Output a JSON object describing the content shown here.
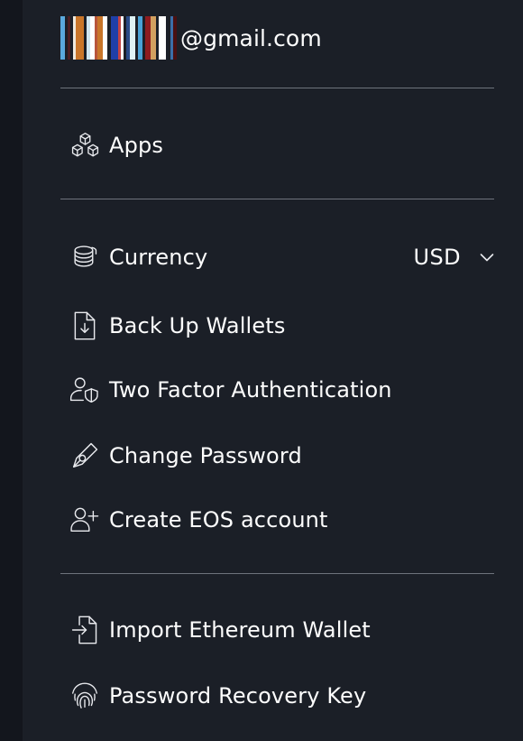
{
  "account": {
    "masked_label": "masked email username",
    "domain": "@gmail.com",
    "mask_bars": [
      {
        "color": "#5aa9dd",
        "width": 5
      },
      {
        "color": "#1b1f27",
        "width": 3
      },
      {
        "color": "#4a1f22",
        "width": 3
      },
      {
        "color": "#1b1f27",
        "width": 3
      },
      {
        "color": "#efeade",
        "width": 3
      },
      {
        "color": "#c9762a",
        "width": 9
      },
      {
        "color": "#1b1f27",
        "width": 3
      },
      {
        "color": "#cfe6f2",
        "width": 4
      },
      {
        "color": "#ffffff",
        "width": 5
      },
      {
        "color": "#b8543a",
        "width": 3
      },
      {
        "color": "#c9762a",
        "width": 6
      },
      {
        "color": "#ffffff",
        "width": 5
      },
      {
        "color": "#1b1f27",
        "width": 4
      },
      {
        "color": "#1f3fa8",
        "width": 8
      },
      {
        "color": "#c24444",
        "width": 3
      },
      {
        "color": "#ffffff",
        "width": 3
      },
      {
        "color": "#1b1f27",
        "width": 3
      },
      {
        "color": "#2a4a86",
        "width": 4
      },
      {
        "color": "#dff3f5",
        "width": 6
      },
      {
        "color": "#1b1f27",
        "width": 3
      },
      {
        "color": "#4aa2d6",
        "width": 5
      },
      {
        "color": "#1b1f27",
        "width": 3
      },
      {
        "color": "#8e1c1f",
        "width": 6
      },
      {
        "color": "#d2a05f",
        "width": 6
      },
      {
        "color": "#1b1f27",
        "width": 3
      },
      {
        "color": "#ffffff",
        "width": 8
      },
      {
        "color": "#1b1f27",
        "width": 5
      },
      {
        "color": "#3b6fa8",
        "width": 3
      },
      {
        "color": "#4a1012",
        "width": 4
      }
    ]
  },
  "sections": [
    {
      "name": "apps",
      "items": [
        {
          "id": "apps",
          "label": "Apps",
          "icon": "cubes-icon"
        }
      ]
    },
    {
      "name": "settings",
      "items": [
        {
          "id": "currency",
          "label": "Currency",
          "icon": "coins-icon",
          "value": "USD",
          "trailing_icon": "chevron-down-icon"
        },
        {
          "id": "backup-wallets",
          "label": "Back Up Wallets",
          "icon": "file-download-icon"
        },
        {
          "id": "two-factor-authentication",
          "label": "Two Factor Authentication",
          "icon": "user-shield-icon"
        },
        {
          "id": "change-password",
          "label": "Change Password",
          "icon": "pen-nib-icon"
        },
        {
          "id": "create-eos-account",
          "label": "Create EOS account",
          "icon": "user-plus-icon"
        }
      ]
    },
    {
      "name": "advanced",
      "items": [
        {
          "id": "import-ethereum-wallet",
          "label": "Import Ethereum Wallet",
          "icon": "file-import-icon"
        },
        {
          "id": "password-recovery-key",
          "label": "Password Recovery Key",
          "icon": "fingerprint-icon"
        }
      ]
    }
  ],
  "colors": {
    "background": "#1b1f27",
    "edge": "#13161d",
    "text": "#fdfdfd",
    "icon": "#e9eaee",
    "divider": "#8b9099"
  }
}
